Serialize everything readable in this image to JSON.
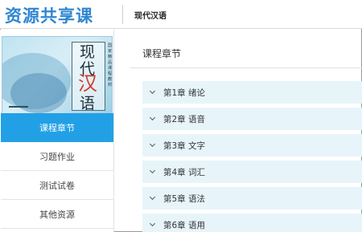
{
  "header": {
    "brand": "资源共享课",
    "course_title": "现代汉语"
  },
  "cover": {
    "chars": [
      "现",
      "代",
      "汉",
      "语"
    ],
    "subtitle": "国家精品课程教材"
  },
  "sidebar": {
    "items": [
      {
        "label": "课程章节",
        "active": true
      },
      {
        "label": "习题作业",
        "active": false
      },
      {
        "label": "测试试卷",
        "active": false
      },
      {
        "label": "其他资源",
        "active": false
      }
    ]
  },
  "main": {
    "section_title": "课程章节",
    "chapters": [
      {
        "label": "第1章 绪论"
      },
      {
        "label": "第2章 语音"
      },
      {
        "label": "第3章 文字"
      },
      {
        "label": "第4章 词汇"
      },
      {
        "label": "第5章 语法"
      },
      {
        "label": "第6章 语用"
      }
    ]
  },
  "colors": {
    "brand": "#2f86d1",
    "active_nav": "#22a0e6",
    "chapter_bg": "#e7f5fb"
  },
  "icons": {
    "chapter_expand": "chevron-down-icon"
  }
}
